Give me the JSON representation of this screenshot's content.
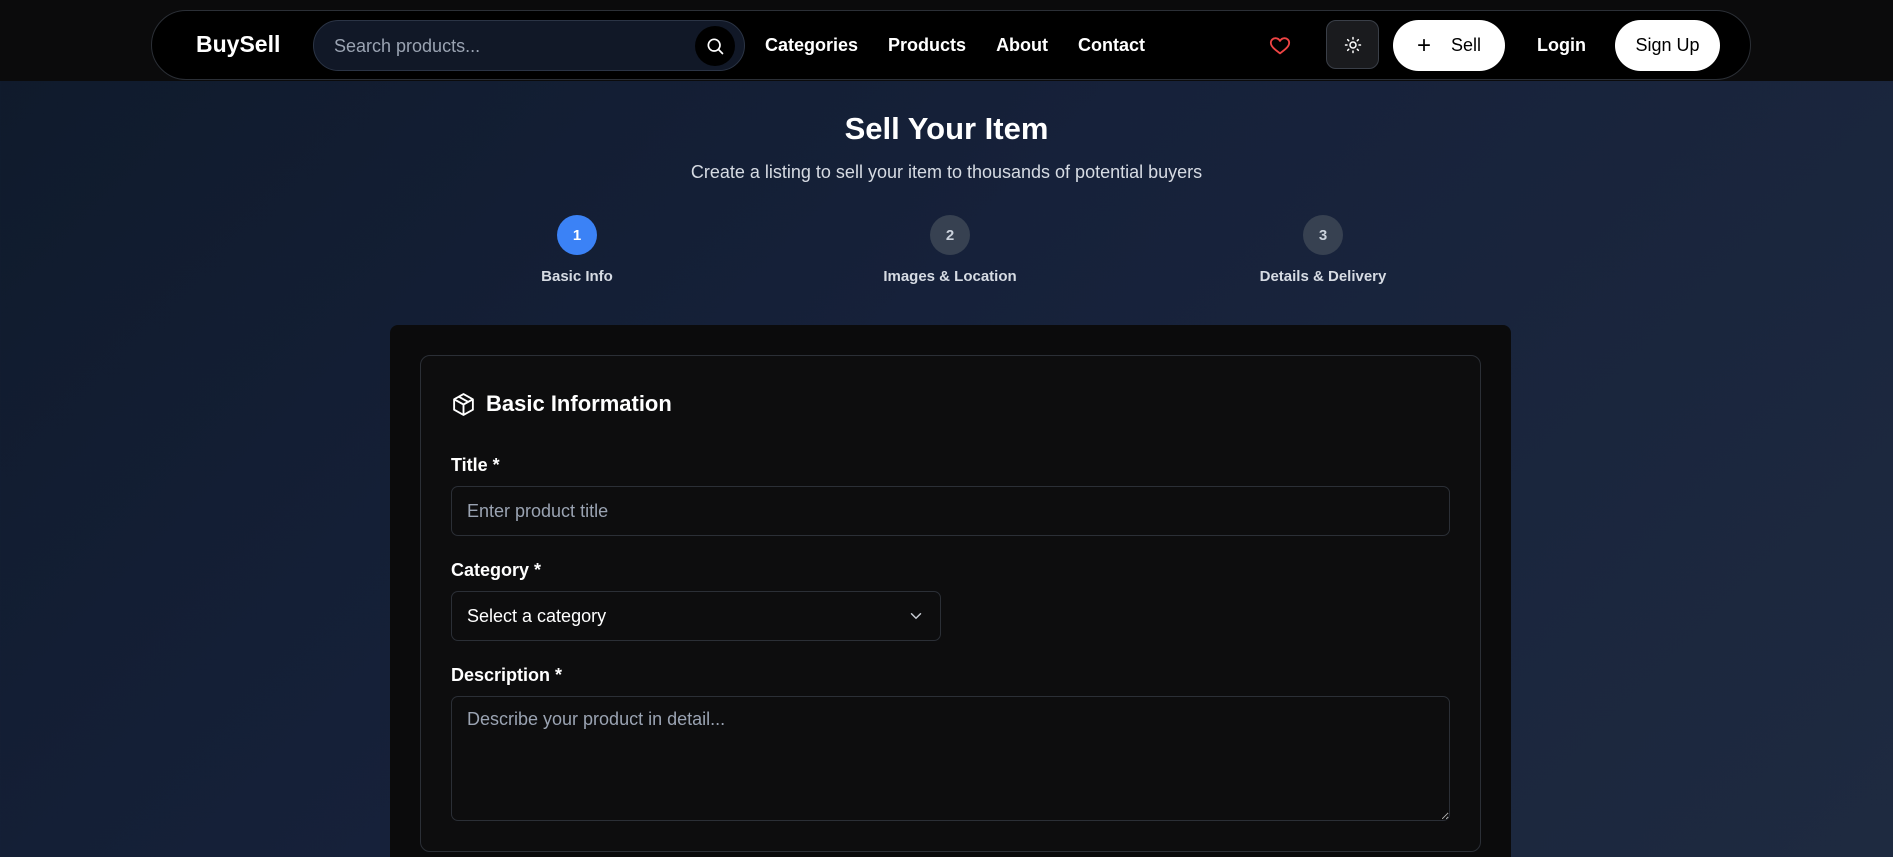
{
  "header": {
    "brand": "BuySell",
    "search": {
      "placeholder": "Search products...",
      "value": ""
    },
    "nav": [
      "Categories",
      "Products",
      "About",
      "Contact"
    ],
    "sell_label": "Sell",
    "login_label": "Login",
    "signup_label": "Sign Up",
    "icons": {
      "search": "search-icon",
      "favorites": "heart-icon",
      "theme": "sun-icon",
      "add": "plus-icon"
    }
  },
  "page": {
    "title": "Sell Your Item",
    "subtitle": "Create a listing to sell your item to thousands of potential buyers"
  },
  "steps": [
    {
      "number": "1",
      "label": "Basic Info",
      "active": true
    },
    {
      "number": "2",
      "label": "Images & Location",
      "active": false
    },
    {
      "number": "3",
      "label": "Details & Delivery",
      "active": false
    }
  ],
  "form": {
    "section_title": "Basic Information",
    "section_icon": "package-icon",
    "title_label": "Title *",
    "title_placeholder": "Enter product title",
    "title_value": "",
    "category_label": "Category *",
    "category_value": "Select a category",
    "description_label": "Description *",
    "description_placeholder": "Describe your product in detail...",
    "description_value": ""
  },
  "colors": {
    "accent": "#3b82f6",
    "heart": "#ef4444",
    "inactive_step": "#374151",
    "background_dark": "#0d0d0e"
  }
}
